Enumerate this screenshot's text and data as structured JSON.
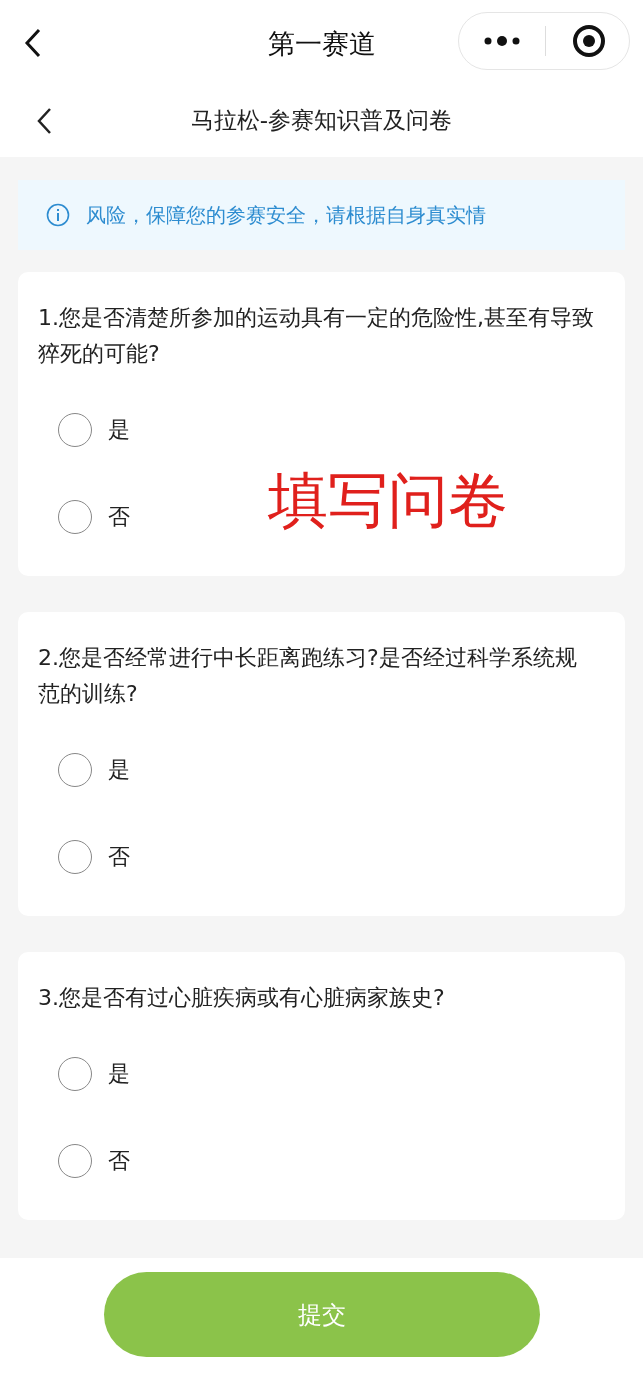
{
  "nav_bar": {
    "title": "第一赛道"
  },
  "page_header": {
    "title": "马拉松-参赛知识普及问卷"
  },
  "notice": {
    "text": "风险，保障您的参赛安全，请根据自身真实情"
  },
  "questions": [
    {
      "title": "1.您是否清楚所参加的运动具有一定的危险性,甚至有导致猝死的可能?",
      "options": [
        {
          "label": "是",
          "selected": false
        },
        {
          "label": "否",
          "selected": false
        }
      ]
    },
    {
      "title": "2.您是否经常进行中长距离跑练习?是否经过科学系统规范的训练?",
      "options": [
        {
          "label": "是",
          "selected": false
        },
        {
          "label": "否",
          "selected": false
        }
      ]
    },
    {
      "title": "3.您是否有过心脏疾病或有心脏病家族史?",
      "options": [
        {
          "label": "是",
          "selected": false
        },
        {
          "label": "否",
          "selected": false
        }
      ]
    }
  ],
  "annotation": {
    "text": "填写问卷"
  },
  "submit_button": {
    "label": "提交"
  }
}
